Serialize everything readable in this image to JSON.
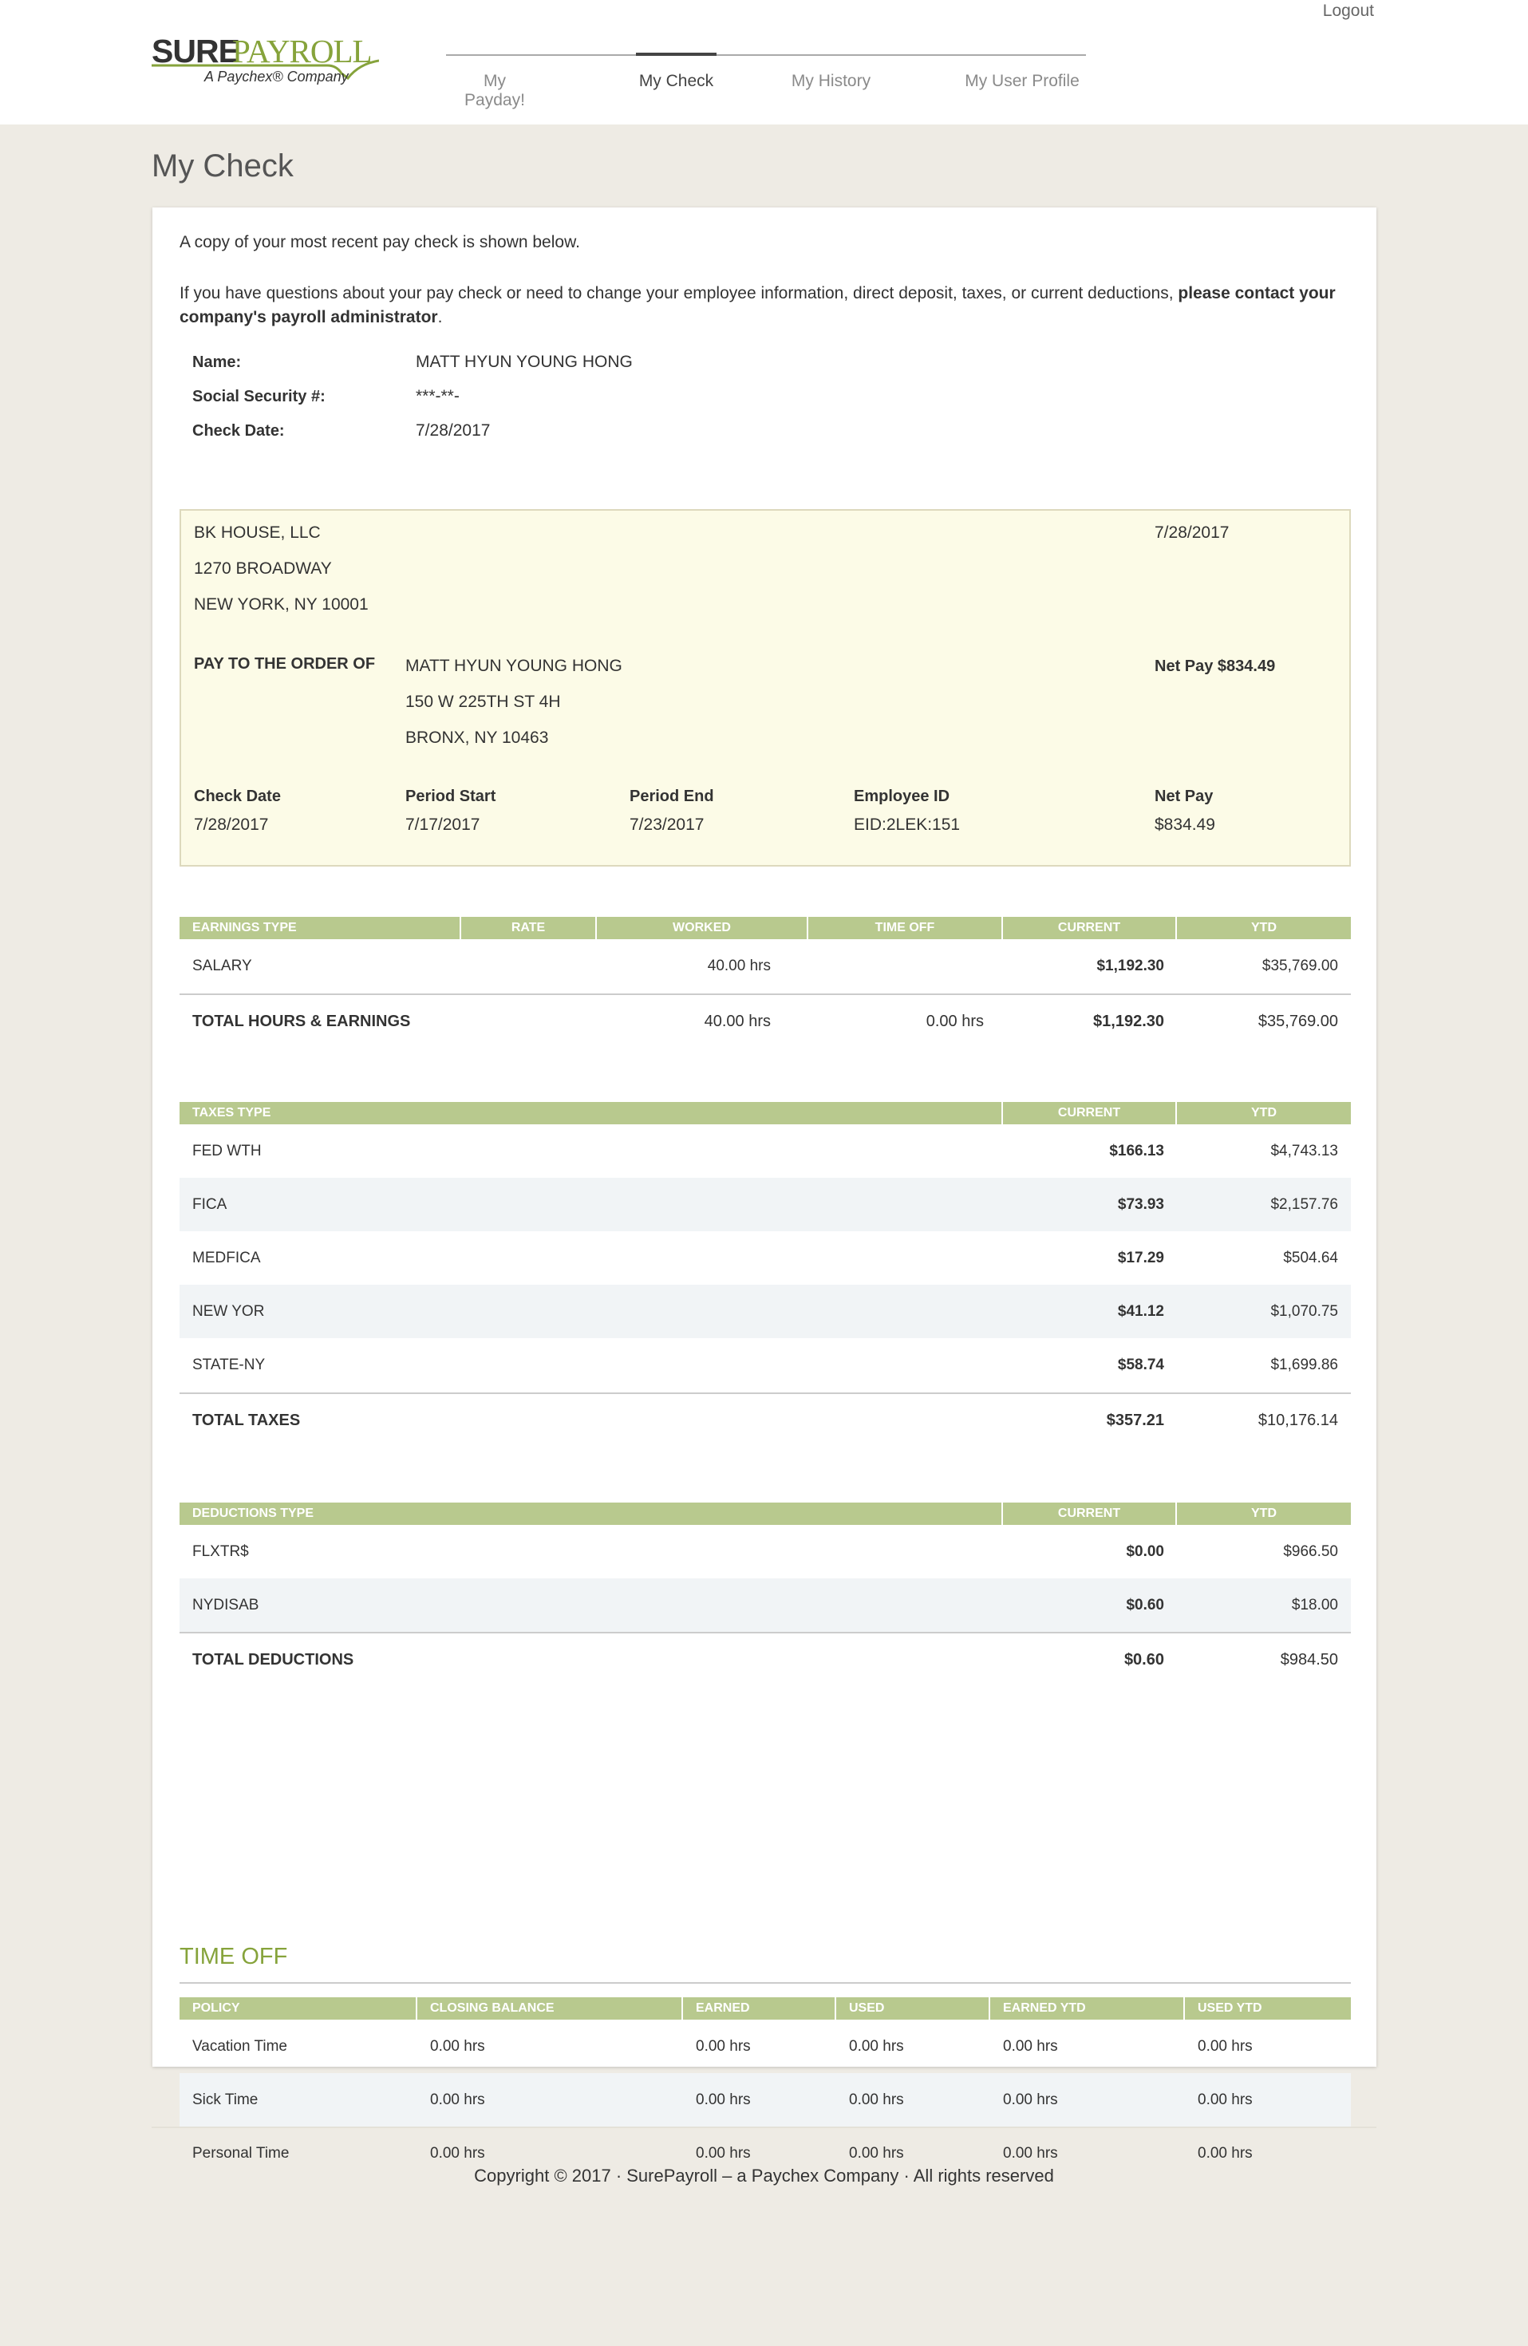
{
  "header": {
    "logout_label": "Logout",
    "logo": {
      "sure": "SURE",
      "payroll": "PAYROLL",
      "tagline": "A Paychex® Company"
    },
    "nav": [
      "My Payday!",
      "My Check",
      "My History",
      "My User Profile"
    ],
    "active_nav": "My Check"
  },
  "page_title": "My Check",
  "intro": {
    "line1": "A copy of your most recent pay check is shown below.",
    "line2_normal": "If you have questions about your pay check or need to change your employee information, direct deposit, taxes, or current deductions, ",
    "line2_bold": "please contact your company's payroll administrator",
    "line2_end": "."
  },
  "employee": {
    "name_label": "Name:",
    "name": "MATT HYUN YOUNG HONG",
    "ssn_label": "Social Security #:",
    "ssn": "***-**-",
    "check_date_label": "Check Date:",
    "check_date": "7/28/2017"
  },
  "check": {
    "company_name": "BK HOUSE, LLC",
    "company_address1": "1270 BROADWAY",
    "company_address2": "NEW YORK, NY 10001",
    "date": "7/28/2017",
    "pay_to_label": "PAY TO THE ORDER OF",
    "payee_name": "MATT HYUN YOUNG HONG",
    "payee_address1": "150 W 225TH ST 4H",
    "payee_address2": "BRONX, NY 10463",
    "net_pay_top": "Net Pay $834.49",
    "check_date_label": "Check Date",
    "check_date": "7/28/2017",
    "period_start_label": "Period Start",
    "period_start": "7/17/2017",
    "period_end_label": "Period End",
    "period_end": "7/23/2017",
    "employee_id_label": "Employee ID",
    "employee_id": "EID:2LEK:151",
    "net_pay_label": "Net Pay",
    "net_pay": "$834.49"
  },
  "earnings": {
    "headers": [
      "EARNINGS TYPE",
      "RATE",
      "WORKED",
      "TIME OFF",
      "CURRENT",
      "YTD"
    ],
    "rows": [
      {
        "type": "SALARY",
        "rate": "",
        "worked": "40.00 hrs",
        "time_off": "",
        "current": "$1,192.30",
        "ytd": "$35,769.00"
      }
    ],
    "total": {
      "label": "TOTAL HOURS & EARNINGS",
      "worked": "40.00 hrs",
      "time_off": "0.00 hrs",
      "current": "$1,192.30",
      "ytd": "$35,769.00"
    }
  },
  "taxes": {
    "headers": [
      "TAXES TYPE",
      "CURRENT",
      "YTD"
    ],
    "rows": [
      {
        "type": "FED WTH",
        "current": "$166.13",
        "ytd": "$4,743.13"
      },
      {
        "type": "FICA",
        "current": "$73.93",
        "ytd": "$2,157.76"
      },
      {
        "type": "MEDFICA",
        "current": "$17.29",
        "ytd": "$504.64"
      },
      {
        "type": "NEW YOR",
        "current": "$41.12",
        "ytd": "$1,070.75"
      },
      {
        "type": "STATE-NY",
        "current": "$58.74",
        "ytd": "$1,699.86"
      }
    ],
    "total": {
      "label": "TOTAL TAXES",
      "current": "$357.21",
      "ytd": "$10,176.14"
    }
  },
  "deductions": {
    "headers": [
      "DEDUCTIONS TYPE",
      "CURRENT",
      "YTD"
    ],
    "rows": [
      {
        "type": "FLXTR$",
        "current": "$0.00",
        "ytd": "$966.50"
      },
      {
        "type": "NYDISAB",
        "current": "$0.60",
        "ytd": "$18.00"
      }
    ],
    "total": {
      "label": "TOTAL DEDUCTIONS",
      "current": "$0.60",
      "ytd": "$984.50"
    }
  },
  "time_off": {
    "title": "TIME OFF",
    "headers": [
      "POLICY",
      "CLOSING BALANCE",
      "EARNED",
      "USED",
      "EARNED YTD",
      "USED YTD"
    ],
    "rows": [
      {
        "policy": "Vacation Time",
        "closing": "0.00 hrs",
        "earned": "0.00 hrs",
        "used": "0.00 hrs",
        "earned_ytd": "0.00 hrs",
        "used_ytd": "0.00 hrs"
      },
      {
        "policy": "Sick Time",
        "closing": "0.00 hrs",
        "earned": "0.00 hrs",
        "used": "0.00 hrs",
        "earned_ytd": "0.00 hrs",
        "used_ytd": "0.00 hrs"
      },
      {
        "policy": "Personal Time",
        "closing": "0.00 hrs",
        "earned": "0.00 hrs",
        "used": "0.00 hrs",
        "earned_ytd": "0.00 hrs",
        "used_ytd": "0.00 hrs"
      }
    ]
  },
  "footer": "Copyright © 2017 · SurePayroll – a Paychex Company · All rights reserved",
  "colors": {
    "accent_green": "#86a33b",
    "header_green": "#b8c98e",
    "check_bg": "#fcfbe7",
    "page_bg": "#eeebe4"
  }
}
